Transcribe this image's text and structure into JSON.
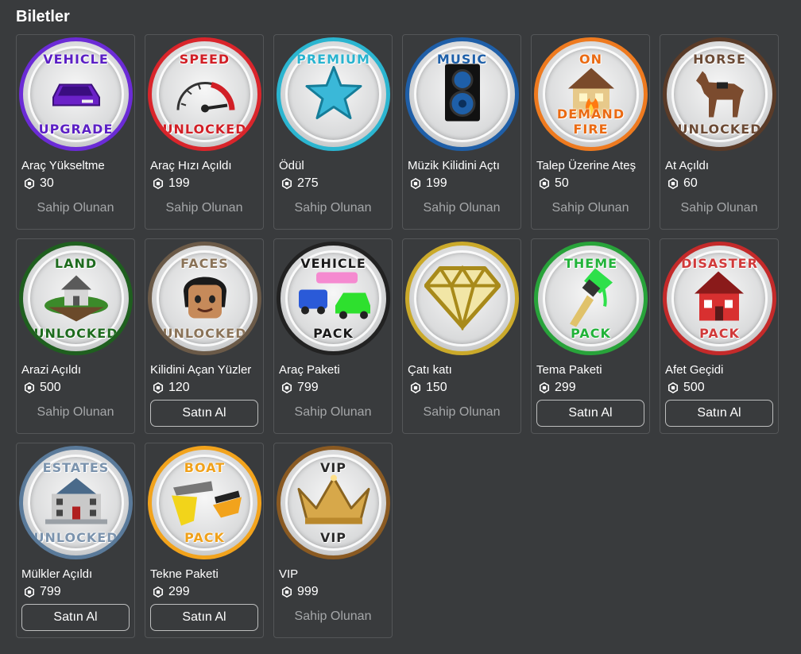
{
  "section_title": "Biletler",
  "owned_label": "Sahip Olunan",
  "buy_label": "Satın Al",
  "items": [
    {
      "name": "Araç Yükseltme",
      "price": "30",
      "status": "owned",
      "top_text": "VEHICLE",
      "bottom_text": "UPGRADE",
      "border_color": "#6b2bd6",
      "text_color": "#5b1fc4",
      "art": "car-icon"
    },
    {
      "name": "Araç Hızı Açıldı",
      "price": "199",
      "status": "owned",
      "top_text": "SPEED",
      "bottom_text": "UNLOCKED",
      "border_color": "#d9252b",
      "text_color": "#d11f26",
      "art": "speedometer-icon"
    },
    {
      "name": "Ödül",
      "price": "275",
      "status": "owned",
      "top_text": "PREMIUM",
      "bottom_text": "",
      "border_color": "#2bb5d0",
      "text_color": "#29b3cf",
      "art": "star-icon"
    },
    {
      "name": "Müzik Kilidini Açtı",
      "price": "199",
      "status": "owned",
      "top_text": "MUSIC",
      "bottom_text": "",
      "border_color": "#1f5fa8",
      "text_color": "#1e5fa8",
      "art": "speaker-icon"
    },
    {
      "name": "Talep Üzerine Ateş",
      "price": "50",
      "status": "owned",
      "top_text": "ON",
      "bottom_text": "DEMAND FIRE",
      "border_color": "#ee7a1f",
      "text_color": "#ea6a12",
      "art": "house-fire-icon"
    },
    {
      "name": "At Açıldı",
      "price": "60",
      "status": "owned",
      "top_text": "HORSE",
      "bottom_text": "UNLOCKED",
      "border_color": "#5a3b28",
      "text_color": "#6b4a35",
      "art": "horse-icon"
    },
    {
      "name": "Arazi Açıldı",
      "price": "500",
      "status": "owned",
      "top_text": "LAND",
      "bottom_text": "UNLOCKED",
      "border_color": "#1f5f1f",
      "text_color": "#1e6b1e",
      "art": "island-house-icon"
    },
    {
      "name": "Kilidini Açan Yüzler",
      "price": "120",
      "status": "buy",
      "top_text": "FACES",
      "bottom_text": "UNLOCKED",
      "border_color": "#6b5a48",
      "text_color": "#8a7358",
      "art": "avatar-face-icon"
    },
    {
      "name": "Araç Paketi",
      "price": "799",
      "status": "owned",
      "top_text": "VEHICLE",
      "bottom_text": "PACK",
      "border_color": "#222222",
      "text_color": "#1a1a1a",
      "art": "vehicles-icon"
    },
    {
      "name": "Çatı katı",
      "price": "150",
      "status": "owned",
      "top_text": "",
      "bottom_text": "",
      "border_color": "#caa92a",
      "text_color": "#b8951a",
      "art": "diamond-icon"
    },
    {
      "name": "Tema Paketi",
      "price": "299",
      "status": "buy",
      "top_text": "THEME",
      "bottom_text": "PACK",
      "border_color": "#28a33a",
      "text_color": "#22b33a",
      "art": "paintbrush-icon"
    },
    {
      "name": "Afet Geçidi",
      "price": "500",
      "status": "buy",
      "top_text": "DISASTER",
      "bottom_text": "PACK",
      "border_color": "#c42a2a",
      "text_color": "#d13a3a",
      "art": "broken-house-icon"
    },
    {
      "name": "Mülkler Açıldı",
      "price": "799",
      "status": "buy",
      "top_text": "ESTATES",
      "bottom_text": "UNLOCKED",
      "border_color": "#5a7a9a",
      "text_color": "#7b93ad",
      "art": "mansion-icon"
    },
    {
      "name": "Tekne Paketi",
      "price": "299",
      "status": "buy",
      "top_text": "BOAT",
      "bottom_text": "PACK",
      "border_color": "#f2a31c",
      "text_color": "#f0a11a",
      "art": "boats-icon"
    },
    {
      "name": "VIP",
      "price": "999",
      "status": "owned",
      "top_text": "VIP",
      "bottom_text": "VIP",
      "border_color": "#8a5a22",
      "text_color": "#2a2a2a",
      "art": "crown-icon"
    }
  ]
}
